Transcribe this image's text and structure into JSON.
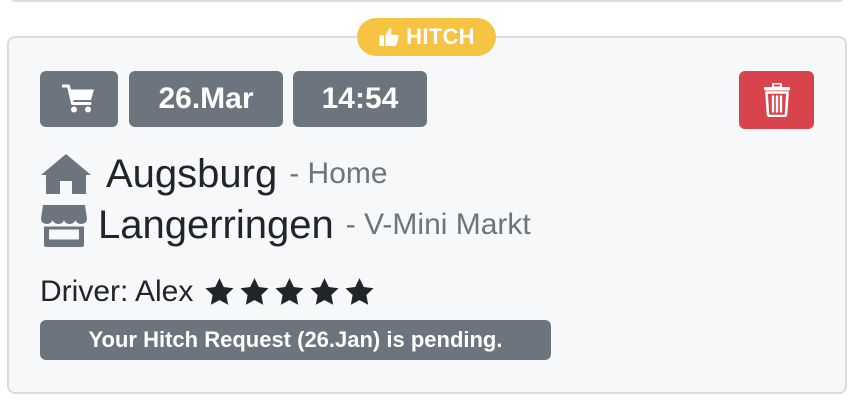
{
  "card": {
    "badge_label": "HITCH",
    "date": "26.Mar",
    "time": "14:54",
    "from": {
      "name": "Augsburg",
      "detail": "- Home"
    },
    "to": {
      "name": "Langerringen",
      "detail": "- V-Mini Markt"
    },
    "driver_label": "Driver: Alex",
    "rating_stars": 5,
    "status_message": "Your Hitch Request (26.Jan) is pending."
  },
  "icons": {
    "badge": "thumbs-up-icon",
    "category": "shopping-cart-icon",
    "delete": "trash-icon",
    "from": "home-icon",
    "to": "store-icon",
    "rating": "star-icon"
  },
  "colors": {
    "badge_bg": "#f6c343",
    "chip_bg": "#6c757d",
    "delete_bg": "#d9434b",
    "card_bg": "#f7f8fa",
    "text": "#212529",
    "muted": "#6c757d"
  }
}
